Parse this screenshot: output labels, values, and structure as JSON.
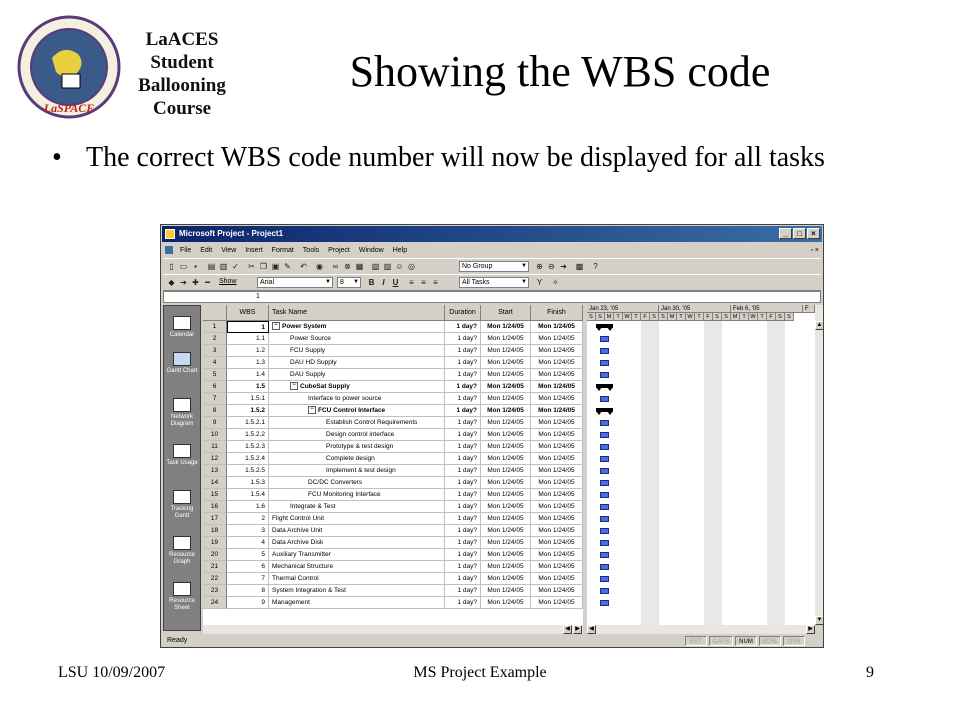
{
  "logo": {
    "alt": "LaSPACE",
    "lines": [
      "LaACES",
      "Student",
      "Ballooning",
      "Course"
    ]
  },
  "slide": {
    "title": "Showing the WBS code",
    "bullet": "The correct WBS code number will now be displayed for all tasks",
    "footer_left": "LSU 10/09/2007",
    "footer_center": "MS Project Example",
    "page_number": "9"
  },
  "window": {
    "title": "Microsoft Project - Project1",
    "menu": [
      "File",
      "Edit",
      "View",
      "Insert",
      "Format",
      "Tools",
      "Project",
      "Window",
      "Help"
    ],
    "group_combo": "No Group",
    "filter_combo": "All Tasks",
    "show_label": "Show",
    "font_combo": "Arial",
    "size_combo": "8",
    "entry_value": "1",
    "status_text": "Ready",
    "status_indicators": [
      "EXT",
      "CAPS",
      "NUM",
      "SCRL",
      "OVR"
    ],
    "active_indicator": "NUM"
  },
  "viewbar": [
    {
      "label": "Calendar"
    },
    {
      "label": "Gantt Chart"
    },
    {
      "label": "Network Diagram"
    },
    {
      "label": "Task Usage"
    },
    {
      "label": "Tracking Gantt"
    },
    {
      "label": "Resource Graph"
    },
    {
      "label": "Resource Sheet"
    }
  ],
  "columns": [
    "WBS",
    "Task Name",
    "Duration",
    "Start",
    "Finish"
  ],
  "gantt": {
    "weeks": [
      "Jan 23, '05",
      "Jan 30, '05",
      "Feb 6, '05",
      "F"
    ],
    "days": [
      "S",
      "S",
      "M",
      "T",
      "W",
      "T",
      "F",
      "S",
      "S",
      "M",
      "T",
      "W",
      "T",
      "F",
      "S",
      "S",
      "M",
      "T",
      "W",
      "T",
      "F",
      "S",
      "S"
    ]
  },
  "tasks": [
    {
      "id": "1",
      "wbs": "1",
      "name": "Power System",
      "dur": "1 day?",
      "start": "Mon 1/24/05",
      "finish": "Mon 1/24/05",
      "indent": 0,
      "summary": true
    },
    {
      "id": "2",
      "wbs": "1.1",
      "name": "Power Source",
      "dur": "1 day?",
      "start": "Mon 1/24/05",
      "finish": "Mon 1/24/05",
      "indent": 1,
      "summary": false
    },
    {
      "id": "3",
      "wbs": "1.2",
      "name": "FCU Supply",
      "dur": "1 day?",
      "start": "Mon 1/24/05",
      "finish": "Mon 1/24/05",
      "indent": 1,
      "summary": false
    },
    {
      "id": "4",
      "wbs": "1.3",
      "name": "DAU HD Supply",
      "dur": "1 day?",
      "start": "Mon 1/24/05",
      "finish": "Mon 1/24/05",
      "indent": 1,
      "summary": false
    },
    {
      "id": "5",
      "wbs": "1.4",
      "name": "DAU Supply",
      "dur": "1 day?",
      "start": "Mon 1/24/05",
      "finish": "Mon 1/24/05",
      "indent": 1,
      "summary": false
    },
    {
      "id": "6",
      "wbs": "1.5",
      "name": "CubeSat Supply",
      "dur": "1 day?",
      "start": "Mon 1/24/05",
      "finish": "Mon 1/24/05",
      "indent": 1,
      "summary": true
    },
    {
      "id": "7",
      "wbs": "1.5.1",
      "name": "Interface to power source",
      "dur": "1 day?",
      "start": "Mon 1/24/05",
      "finish": "Mon 1/24/05",
      "indent": 2,
      "summary": false
    },
    {
      "id": "8",
      "wbs": "1.5.2",
      "name": "FCU Control Interface",
      "dur": "1 day?",
      "start": "Mon 1/24/05",
      "finish": "Mon 1/24/05",
      "indent": 2,
      "summary": true
    },
    {
      "id": "9",
      "wbs": "1.5.2.1",
      "name": "Establish Control Requirements",
      "dur": "1 day?",
      "start": "Mon 1/24/05",
      "finish": "Mon 1/24/05",
      "indent": 3,
      "summary": false
    },
    {
      "id": "10",
      "wbs": "1.5.2.2",
      "name": "Design control interface",
      "dur": "1 day?",
      "start": "Mon 1/24/05",
      "finish": "Mon 1/24/05",
      "indent": 3,
      "summary": false
    },
    {
      "id": "11",
      "wbs": "1.5.2.3",
      "name": "Prototype & test design",
      "dur": "1 day?",
      "start": "Mon 1/24/05",
      "finish": "Mon 1/24/05",
      "indent": 3,
      "summary": false
    },
    {
      "id": "12",
      "wbs": "1.5.2.4",
      "name": "Complete design",
      "dur": "1 day?",
      "start": "Mon 1/24/05",
      "finish": "Mon 1/24/05",
      "indent": 3,
      "summary": false
    },
    {
      "id": "13",
      "wbs": "1.5.2.5",
      "name": "Implement & test design",
      "dur": "1 day?",
      "start": "Mon 1/24/05",
      "finish": "Mon 1/24/05",
      "indent": 3,
      "summary": false
    },
    {
      "id": "14",
      "wbs": "1.5.3",
      "name": "DC/DC Converters",
      "dur": "1 day?",
      "start": "Mon 1/24/05",
      "finish": "Mon 1/24/05",
      "indent": 2,
      "summary": false
    },
    {
      "id": "15",
      "wbs": "1.5.4",
      "name": "FCU Monitoring Interface",
      "dur": "1 day?",
      "start": "Mon 1/24/05",
      "finish": "Mon 1/24/05",
      "indent": 2,
      "summary": false
    },
    {
      "id": "16",
      "wbs": "1.6",
      "name": "Integrate & Test",
      "dur": "1 day?",
      "start": "Mon 1/24/05",
      "finish": "Mon 1/24/05",
      "indent": 1,
      "summary": false
    },
    {
      "id": "17",
      "wbs": "2",
      "name": "Flight Control Unit",
      "dur": "1 day?",
      "start": "Mon 1/24/05",
      "finish": "Mon 1/24/05",
      "indent": 0,
      "summary": false
    },
    {
      "id": "18",
      "wbs": "3",
      "name": "Data Archive Unit",
      "dur": "1 day?",
      "start": "Mon 1/24/05",
      "finish": "Mon 1/24/05",
      "indent": 0,
      "summary": false
    },
    {
      "id": "19",
      "wbs": "4",
      "name": "Data Archive Disk",
      "dur": "1 day?",
      "start": "Mon 1/24/05",
      "finish": "Mon 1/24/05",
      "indent": 0,
      "summary": false
    },
    {
      "id": "20",
      "wbs": "5",
      "name": "Auxiliary Transmitter",
      "dur": "1 day?",
      "start": "Mon 1/24/05",
      "finish": "Mon 1/24/05",
      "indent": 0,
      "summary": false
    },
    {
      "id": "21",
      "wbs": "6",
      "name": "Mechanical Structure",
      "dur": "1 day?",
      "start": "Mon 1/24/05",
      "finish": "Mon 1/24/05",
      "indent": 0,
      "summary": false
    },
    {
      "id": "22",
      "wbs": "7",
      "name": "Thermal Control",
      "dur": "1 day?",
      "start": "Mon 1/24/05",
      "finish": "Mon 1/24/05",
      "indent": 0,
      "summary": false
    },
    {
      "id": "23",
      "wbs": "8",
      "name": "System Integration & Test",
      "dur": "1 day?",
      "start": "Mon 1/24/05",
      "finish": "Mon 1/24/05",
      "indent": 0,
      "summary": false
    },
    {
      "id": "24",
      "wbs": "9",
      "name": "Management",
      "dur": "1 day?",
      "start": "Mon 1/24/05",
      "finish": "Mon 1/24/05",
      "indent": 0,
      "summary": false
    }
  ]
}
